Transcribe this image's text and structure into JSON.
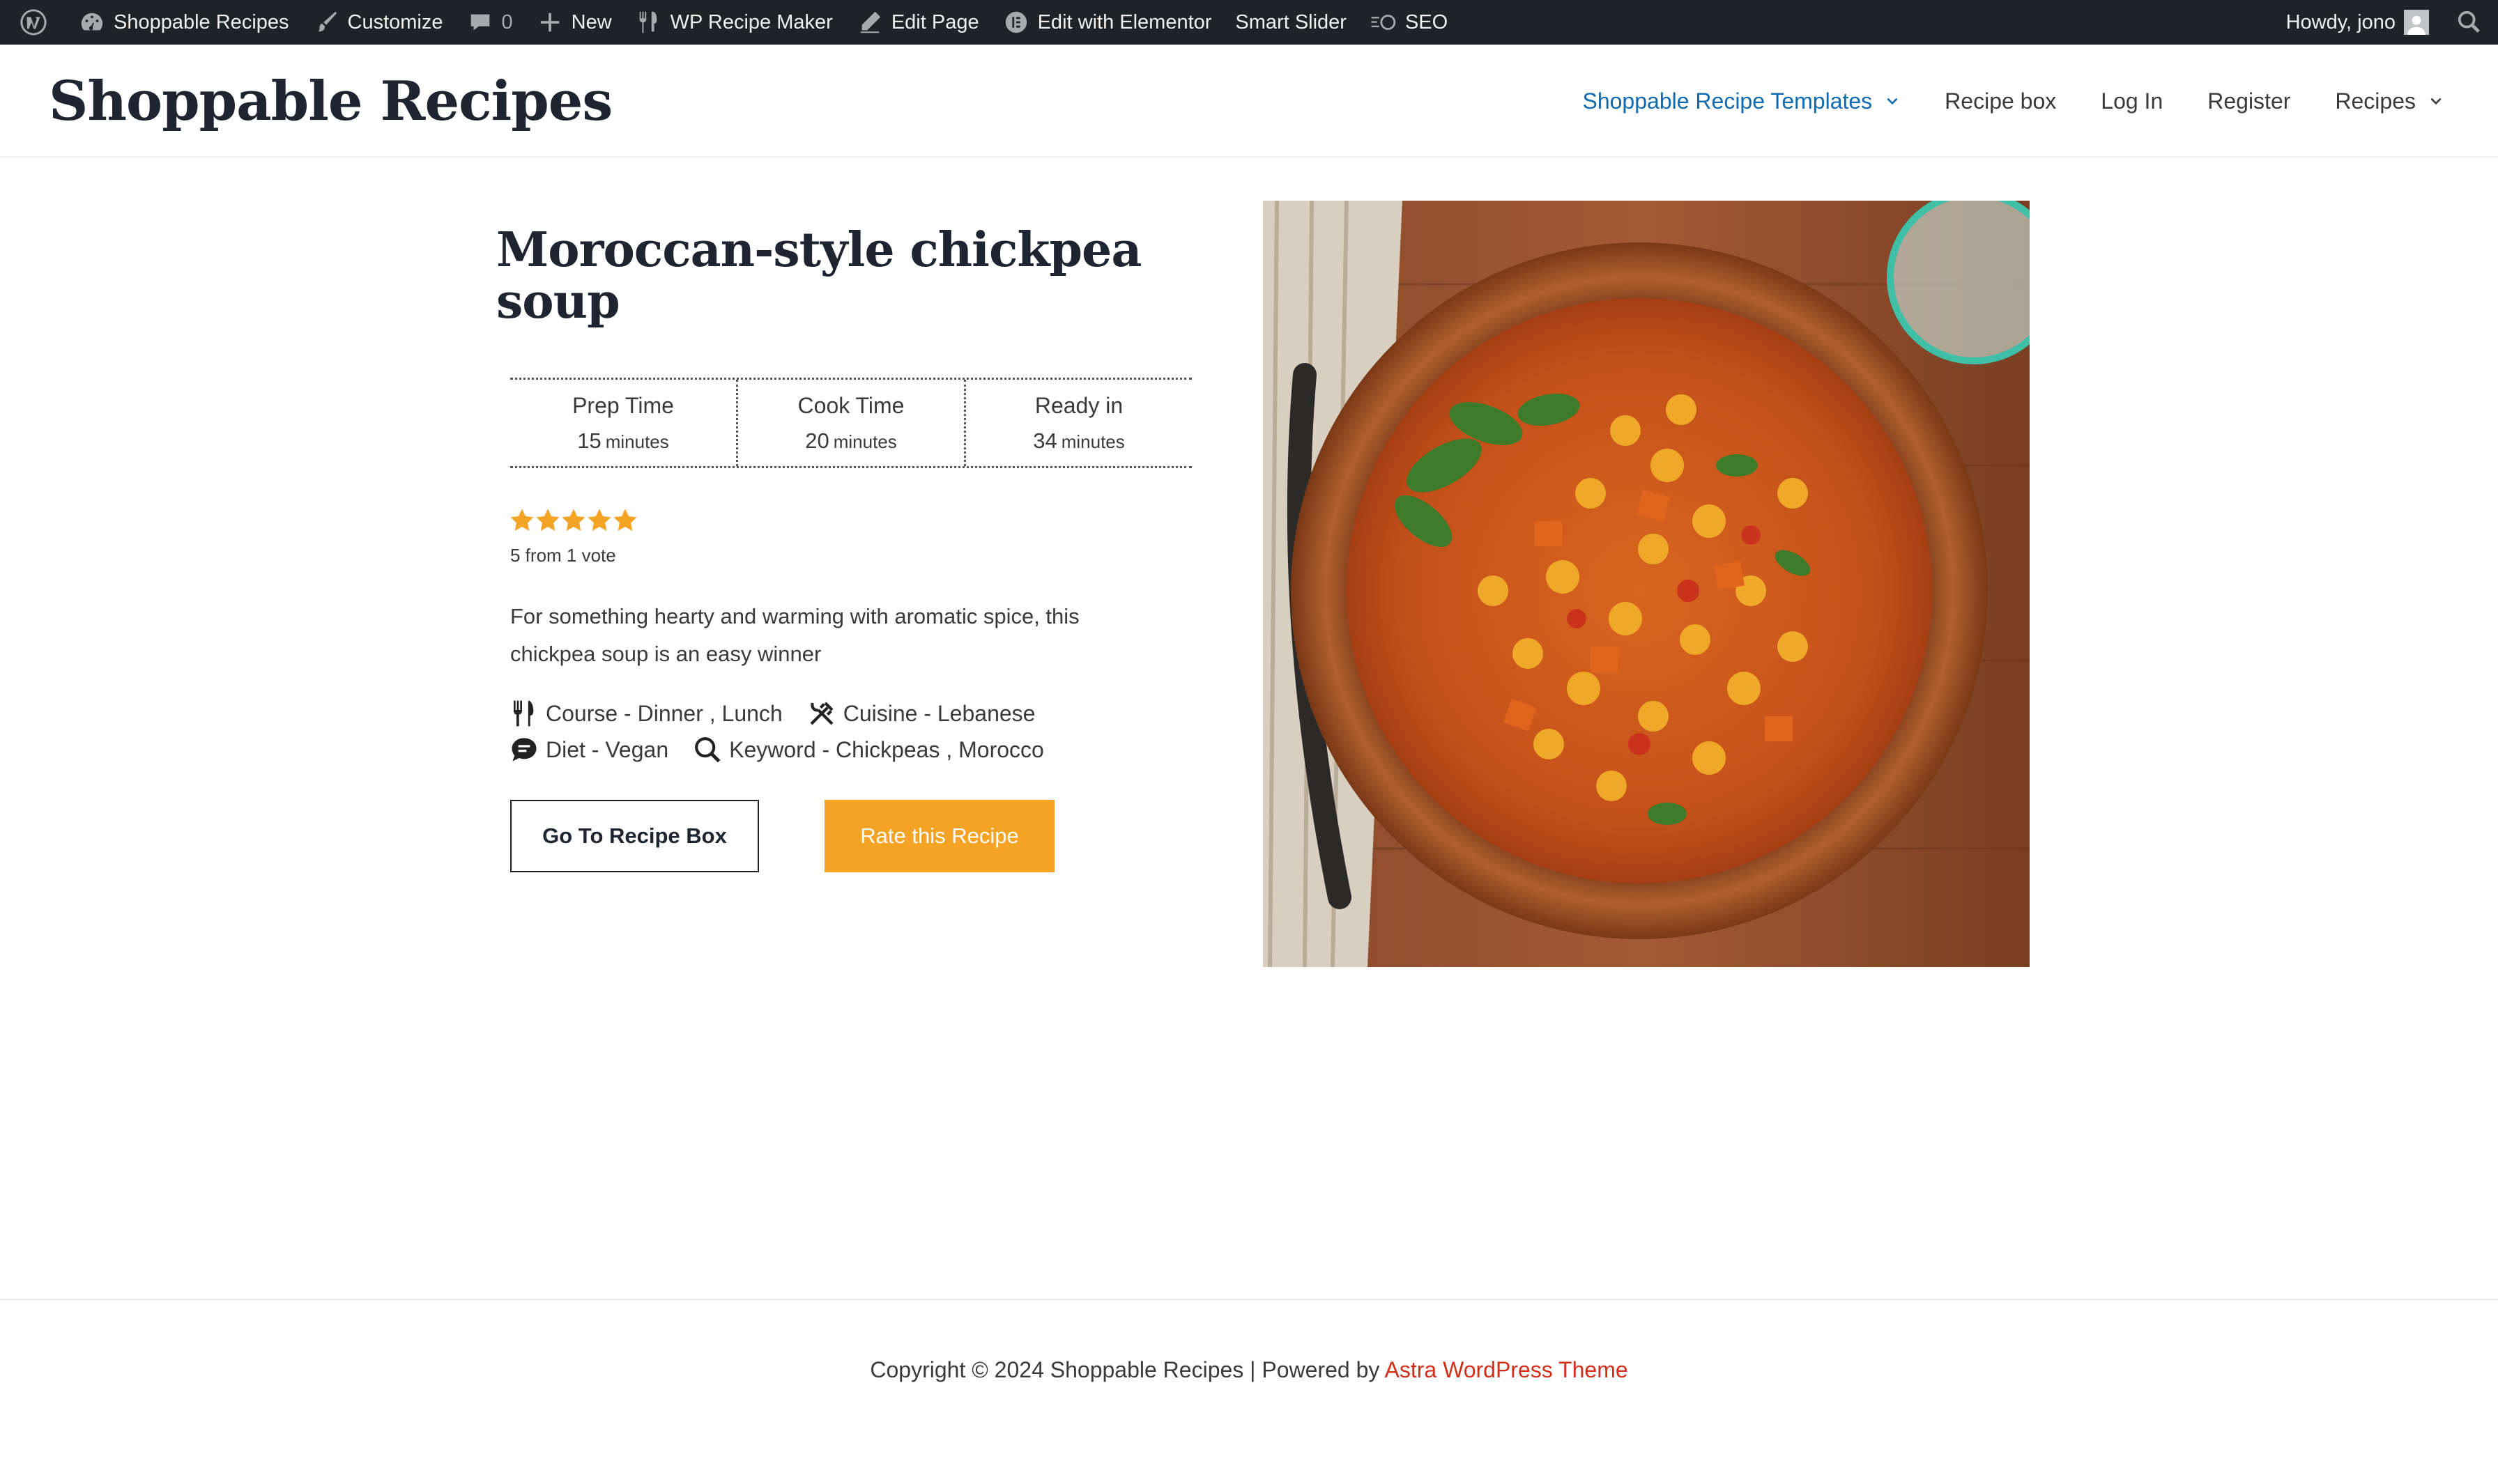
{
  "admin_bar": {
    "site": "Shoppable Recipes",
    "customize": "Customize",
    "comments": "0",
    "new": "New",
    "wprm": "WP Recipe Maker",
    "edit_page": "Edit Page",
    "elementor": "Edit with Elementor",
    "smart_slider": "Smart Slider",
    "seo": "SEO",
    "howdy": "Howdy, jono"
  },
  "header": {
    "site_title": "Shoppable Recipes",
    "nav": [
      "Shoppable Recipe Templates",
      "Recipe box",
      "Log In",
      "Register",
      "Recipes"
    ]
  },
  "recipe": {
    "title": "Moroccan-style chickpea soup",
    "times": [
      {
        "label": "Prep Time",
        "value": "15",
        "unit": "minutes"
      },
      {
        "label": "Cook Time",
        "value": "20",
        "unit": "minutes"
      },
      {
        "label": "Ready in",
        "value": "34",
        "unit": "minutes"
      }
    ],
    "rating": 5,
    "votes": "5 from 1 vote",
    "summary": "For something hearty and warming with aromatic spice, this chickpea soup is an easy winner",
    "course": "Course - Dinner , Lunch",
    "cuisine": "Cuisine - Lebanese",
    "diet": "Diet - Vegan",
    "keyword": "Keyword - Chickpeas , Morocco",
    "btn_box": "Go To Recipe Box",
    "btn_rate": "Rate this Recipe"
  },
  "colors": {
    "accent": "#f4a325",
    "link": "#0f6ab0",
    "footer_link": "#d22f1a"
  },
  "footer": {
    "copyright": "Copyright © 2024 Shoppable Recipes | Powered by ",
    "theme_link": "Astra WordPress Theme"
  }
}
